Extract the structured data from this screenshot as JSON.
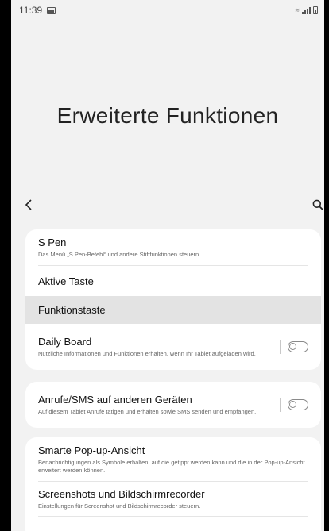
{
  "status_bar": {
    "time": "11:39"
  },
  "page": {
    "title": "Erweiterte Funktionen"
  },
  "card1": {
    "spen": {
      "title": "S Pen",
      "subtitle": "Das Menü „S Pen-Befehl“ und andere Stiftfunktionen steuern."
    },
    "aktive_taste": {
      "title": "Aktive Taste"
    },
    "funktionstaste": {
      "title": "Funktionstaste"
    },
    "daily_board": {
      "title": "Daily Board",
      "subtitle": "Nützliche Informationen und Funktionen erhalten, wenn Ihr Tablet aufgeladen wird.",
      "enabled": false
    }
  },
  "card2": {
    "anrufe": {
      "title": "Anrufe/SMS auf anderen Geräten",
      "subtitle": "Auf diesem Tablet Anrufe tätigen und erhalten sowie SMS senden und empfangen.",
      "enabled": false
    }
  },
  "card3": {
    "popup": {
      "title": "Smarte Pop-up-Ansicht",
      "subtitle": "Benachrichtigungen als Symbole erhalten, auf die getippt werden kann und die in der Pop-up-Ansicht erweitert werden können."
    },
    "screenshots": {
      "title": "Screenshots und Bildschirmrecorder",
      "subtitle": "Einstellungen für Screenshot und Bildschirmrecorder steuern."
    }
  },
  "icons": {
    "back": "chevron-left-icon",
    "search": "search-icon"
  }
}
